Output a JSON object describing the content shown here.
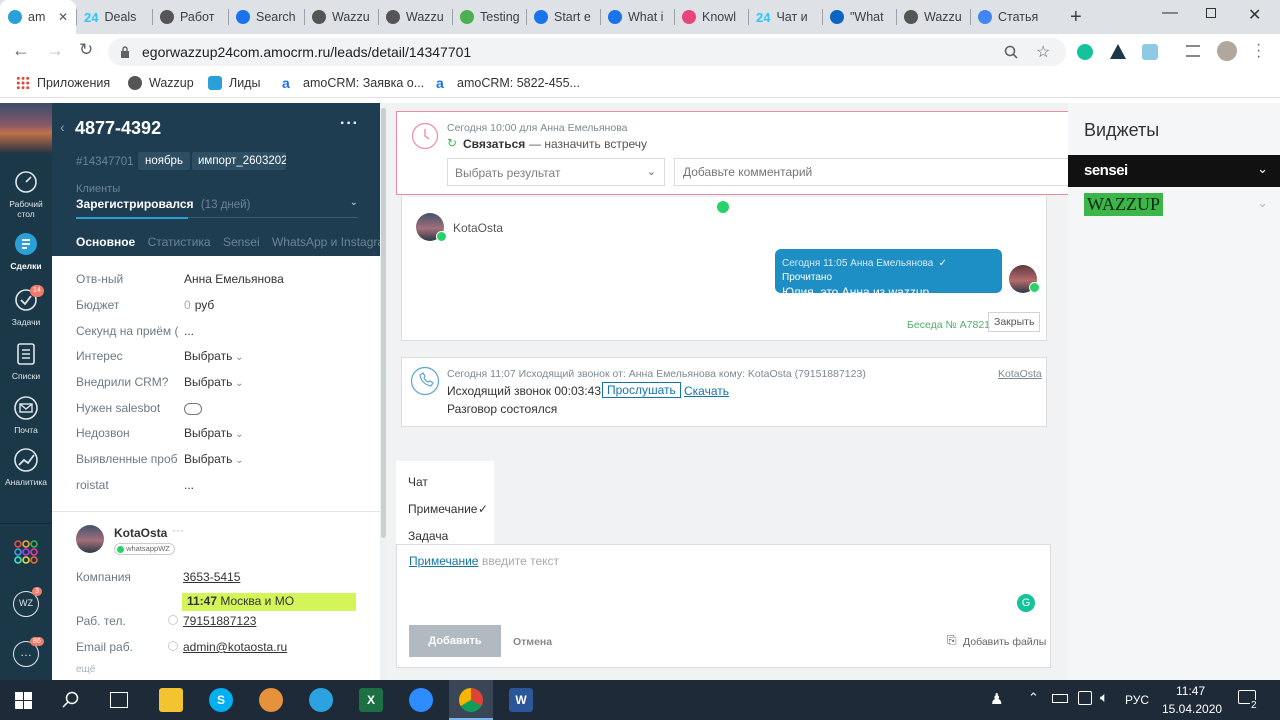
{
  "browser": {
    "tabs": [
      {
        "label": "am",
        "icon": "amocrm-icon",
        "color": "#2aa0d8"
      },
      {
        "label": "Deals",
        "icon": "bitrix24-icon",
        "color": "#2fc6f6",
        "prefix": "24"
      },
      {
        "label": "Работ",
        "icon": "globe-icon",
        "color": "#555"
      },
      {
        "label": "Search",
        "icon": "safari-icon",
        "color": "#1a73e8"
      },
      {
        "label": "Wazzu",
        "icon": "globe-icon",
        "color": "#555"
      },
      {
        "label": "Wazzu",
        "icon": "globe-icon",
        "color": "#555"
      },
      {
        "label": "Testing",
        "icon": "chart-icon",
        "color": "#4caf50"
      },
      {
        "label": "Start e",
        "icon": "book-icon",
        "color": "#1a73e8"
      },
      {
        "label": "What i",
        "icon": "book-icon",
        "color": "#1a73e8"
      },
      {
        "label": "Knowl",
        "icon": "usedesk-icon",
        "color": "#e8457a"
      },
      {
        "label": "Чат и",
        "icon": "bitrix24-icon",
        "color": "#2fc6f6",
        "prefix": "24"
      },
      {
        "label": "\"What",
        "icon": "linkedin-icon",
        "color": "#0a66c2"
      },
      {
        "label": "Wazzu",
        "icon": "globe-icon",
        "color": "#555"
      },
      {
        "label": "Статья",
        "icon": "docs-icon",
        "color": "#4285f4"
      }
    ],
    "url": "egorwazzup24com.amocrm.ru/leads/detail/14347701",
    "bookmarks": [
      {
        "label": "Приложения",
        "icon": "apps-grid-icon"
      },
      {
        "label": "Wazzup",
        "icon": "globe-icon"
      },
      {
        "label": "Лиды",
        "icon": "leads-icon"
      },
      {
        "label": "amoCRM: Заявка о...",
        "icon": "amocrm-icon"
      },
      {
        "label": "amoCRM: 5822-455...",
        "icon": "amocrm-icon"
      }
    ]
  },
  "nav": {
    "items": [
      {
        "label": "Рабочий стол",
        "icon": "dashboard-icon"
      },
      {
        "label": "Сделки",
        "icon": "deals-icon"
      },
      {
        "label": "Задачи",
        "icon": "tasks-icon",
        "badge": "14"
      },
      {
        "label": "Списки",
        "icon": "lists-icon"
      },
      {
        "label": "Почта",
        "icon": "mail-icon"
      },
      {
        "label": "Аналитика",
        "icon": "analytics-icon"
      }
    ],
    "bottom_badges": {
      "wz": "3",
      "chat": "86"
    }
  },
  "lead": {
    "title": "4877-4392",
    "id": "#14347701",
    "tags": [
      "ноябрь",
      "импорт_2603202"
    ],
    "pipeline": "Клиенты",
    "status": "Зарегистрировался",
    "status_days": "(13 дней)",
    "tabs": [
      "Основное",
      "Статистика",
      "Sensei",
      "WhatsApp и Instagram д"
    ],
    "fields": [
      {
        "label": "Отв-ный",
        "value": "Анна Емельянова"
      },
      {
        "label": "Бюджет",
        "value": "0",
        "unit": "руб"
      },
      {
        "label": "Секунд на приём (",
        "value": "..."
      },
      {
        "label": "Интерес",
        "value": "Выбрать"
      },
      {
        "label": "Внедрили CRM?",
        "value": "Выбрать"
      },
      {
        "label": "Нужен salesbot",
        "value": ""
      },
      {
        "label": "Недозвон",
        "value": "Выбрать"
      },
      {
        "label": "Выявленные проб",
        "value": "Выбрать"
      },
      {
        "label": "roistat",
        "value": "..."
      }
    ],
    "contact": {
      "name": "KotaOsta",
      "source": "whatsappWZ",
      "company_label": "Компания",
      "company": "3653-5415",
      "time": "11:47",
      "timezone": "Москва и МО",
      "phone_label": "Раб. тел.",
      "phone": "79151887123",
      "email_label": "Email раб.",
      "email": "admin@kotaosta.ru",
      "more": "ещё"
    }
  },
  "feed": {
    "task": {
      "meta": "Сегодня 10:00 для Анна Емельянова",
      "type": "Связаться",
      "text": "— назначить встречу",
      "result_placeholder": "Выбрать результат",
      "comment_placeholder": "Добавьте комментарий"
    },
    "chat": {
      "contact": "KotaOsta",
      "msg_meta": "Сегодня 11:05 Анна Емельянова",
      "msg_status": "✓ Прочитано",
      "msg_text": "Юлия, это Анна из wazzup",
      "conversation": "Беседа № А7821",
      "close": "Закрыть"
    },
    "call": {
      "meta": "Сегодня 11:07 Исходящий звонок от: Анна Емельянова кому: KotaOsta (79151887123)",
      "contact_link": "KotaOsta",
      "title": "Исходящий звонок 00:03:43",
      "listen": "Прослушать",
      "download": "Скачать",
      "result": "Разговор состоялся"
    },
    "menu": [
      {
        "label": "Чат",
        "checked": false
      },
      {
        "label": "Примечание",
        "checked": true
      },
      {
        "label": "Задача",
        "checked": false
      }
    ],
    "composer": {
      "type_link": "Примечание",
      "placeholder": "введите текст",
      "add": "Добавить",
      "cancel": "Отмена",
      "attach": "Добавить файлы"
    }
  },
  "widgets": {
    "title": "Виджеты",
    "sensei": "sensei",
    "wazzup": "WAZZUP"
  },
  "taskbar": {
    "time": "11:47",
    "date": "15.04.2020",
    "lang": "РУС",
    "notifications": "2"
  },
  "colors": {
    "nav_bg": "#1b3849",
    "lead_head_bg": "#1f3d51",
    "accent": "#1375ab",
    "bubble": "#1e8fc4",
    "whatsapp": "#25d366",
    "highlight": "#d4f55a"
  }
}
